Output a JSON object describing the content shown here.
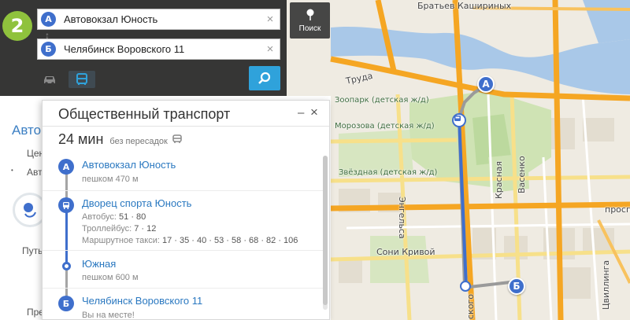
{
  "search": {
    "from": {
      "pin": "A",
      "value": "Автовокзал Юность"
    },
    "to": {
      "pin": "Б",
      "value": "Челябинск Воровского 11"
    },
    "clear_symbol": "×",
    "top_button_label": "Поиск",
    "logo_text": "2"
  },
  "card": {
    "title": "Общественный транспорт",
    "minimize": "–",
    "close": "×",
    "duration": "24 мин",
    "transfers": "без пересадок",
    "steps": [
      {
        "pin": "A",
        "name": "Автовокзал Юность",
        "sub": "пешком 470 м"
      },
      {
        "name": "Дворец спорта Юность",
        "lines": [
          {
            "label": "Автобус:",
            "value": "51 · 80"
          },
          {
            "label": "Троллейбус:",
            "value": "7 · 12"
          },
          {
            "label": "Маршрутное такси:",
            "value": "17 · 35 · 40 · 53 · 58 · 68 · 82 · 106"
          }
        ]
      },
      {
        "name": "Южная",
        "sub": "пешком 600 м"
      },
      {
        "pin": "Б",
        "name": "Челябинск Воровского 11",
        "sub": "Вы на месте!"
      }
    ]
  },
  "side": {
    "title": "Авто",
    "line1": "Цен",
    "line2": "Авт",
    "line3": "Путь",
    "line4": "Пре"
  },
  "map": {
    "labels": {
      "bratiev": "Братьев Кашириных",
      "truda": "Труда",
      "zoopark": "Зоопарк (детская ж/д)",
      "morozova": "Морозова (детская ж/д)",
      "zvezdnaya": "Звёздная (детская ж/д)",
      "engelsa": "Энгельса",
      "krasnaya": "Красная",
      "vasenko": "Васенко",
      "soni": "Сони Кривой",
      "prospect": "просп",
      "cvillinga": "Цвиллинга",
      "vorovskogo": "ского"
    },
    "markers": {
      "a": "A",
      "b": "Б"
    }
  },
  "colors": {
    "accent": "#3f6fcc",
    "go": "#2fa2db",
    "road_major": "#f5a623",
    "road_minor": "#f7e08a",
    "water": "#a9c8e8",
    "park": "#cfe3b4"
  }
}
